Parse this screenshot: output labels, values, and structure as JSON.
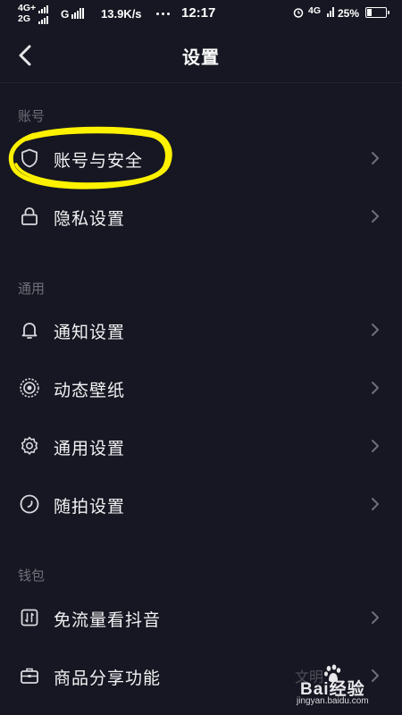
{
  "status_bar": {
    "network_top": "4G+",
    "network_bottom": "2G",
    "network_g": "G",
    "speed": "13.9K/s",
    "time": "12:17",
    "network_right": "4G",
    "battery_percent_text": "25%",
    "battery_level": 0.25
  },
  "nav": {
    "title": "设置"
  },
  "sections": [
    {
      "header": "账号",
      "items": [
        {
          "label": "账号与安全",
          "icon": "shield-icon"
        },
        {
          "label": "隐私设置",
          "icon": "lock-icon"
        }
      ]
    },
    {
      "header": "通用",
      "items": [
        {
          "label": "通知设置",
          "icon": "bell-icon"
        },
        {
          "label": "动态壁纸",
          "icon": "wallpaper-icon"
        },
        {
          "label": "通用设置",
          "icon": "gear-icon"
        },
        {
          "label": "随拍设置",
          "icon": "camera-circle-icon"
        }
      ]
    },
    {
      "header": "钱包",
      "items": [
        {
          "label": "免流量看抖音",
          "icon": "data-free-icon"
        },
        {
          "label": "商品分享功能",
          "icon": "briefcase-icon"
        }
      ]
    }
  ],
  "watermark": {
    "faded_text": "文明",
    "brand": "Bai经验",
    "site": "jingyan.baidu.com"
  },
  "colors": {
    "background": "#161722",
    "annotation": "#fff200",
    "section_header": "#6e6f78",
    "item_text": "#f2f2f4"
  }
}
